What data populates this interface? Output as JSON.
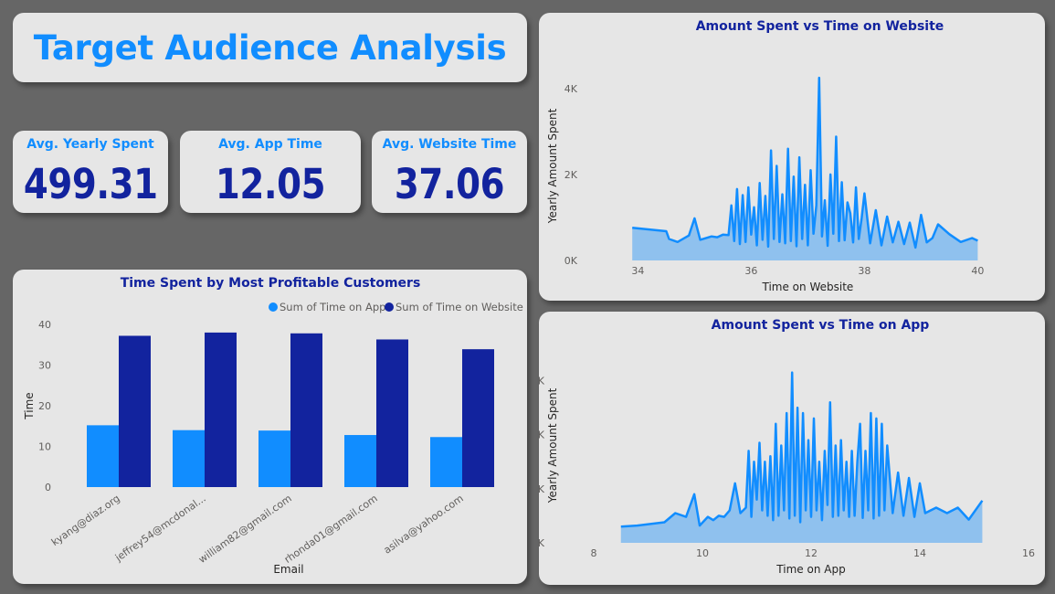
{
  "dashboard": {
    "title": "Target Audience Analysis"
  },
  "kpis": [
    {
      "label": "Avg. Yearly Spent",
      "value": "499.31"
    },
    {
      "label": "Avg. App Time",
      "value": "12.05"
    },
    {
      "label": "Avg. Website Time",
      "value": "37.06"
    }
  ],
  "colors": {
    "accent_light": "#118dff",
    "accent_dark": "#12239e",
    "area_fill": "#8fc1ee",
    "card_bg": "#e6e6e6",
    "page_bg": "#666666"
  },
  "chart_data": [
    {
      "type": "bar",
      "title": "Time Spent by Most Profitable Customers",
      "xlabel": "Email",
      "ylabel": "Time",
      "ylim": [
        0,
        40
      ],
      "yticks": [
        "0",
        "10",
        "20",
        "30",
        "40"
      ],
      "legend_position": "top-right",
      "categories": [
        "kyang@diaz.org",
        "jeffrey54@mcdonal...",
        "william82@gmail.com",
        "rhonda01@gmail.com",
        "asilva@yahoo.com"
      ],
      "series": [
        {
          "name": "Sum of Time on App",
          "color": "#118dff",
          "values": [
            15.2,
            14.0,
            13.9,
            12.8,
            12.3
          ]
        },
        {
          "name": "Sum of Time on Website",
          "color": "#12239e",
          "values": [
            37.2,
            38.0,
            37.8,
            36.3,
            33.9
          ]
        }
      ]
    },
    {
      "type": "area",
      "title": "Amount Spent vs Time on Website",
      "xlabel": "Time on Website",
      "ylabel": "Yearly Amount Spent",
      "xlim": [
        33.8,
        40.3
      ],
      "ylim": [
        0,
        4400
      ],
      "xticks": [
        "34",
        "36",
        "38",
        "40"
      ],
      "yticks": [
        "0K",
        "2K",
        "4K"
      ],
      "xtick_values": [
        34,
        36,
        38,
        40
      ],
      "ytick_values": [
        0,
        2000,
        4000
      ],
      "x": [
        33.9,
        34.5,
        34.55,
        34.7,
        34.9,
        35.0,
        35.1,
        35.3,
        35.4,
        35.5,
        35.6,
        35.65,
        35.7,
        35.75,
        35.8,
        35.85,
        35.9,
        35.95,
        36.0,
        36.05,
        36.1,
        36.15,
        36.2,
        36.25,
        36.3,
        36.35,
        36.4,
        36.45,
        36.5,
        36.55,
        36.6,
        36.65,
        36.7,
        36.75,
        36.8,
        36.85,
        36.9,
        36.95,
        37.0,
        37.05,
        37.1,
        37.15,
        37.2,
        37.25,
        37.3,
        37.35,
        37.4,
        37.45,
        37.5,
        37.55,
        37.6,
        37.65,
        37.7,
        37.75,
        37.8,
        37.85,
        37.9,
        37.95,
        38.0,
        38.1,
        38.2,
        38.3,
        38.4,
        38.5,
        38.6,
        38.7,
        38.8,
        38.9,
        39.0,
        39.1,
        39.2,
        39.3,
        39.5,
        39.7,
        39.9,
        40.0
      ],
      "y": [
        760,
        680,
        500,
        430,
        580,
        980,
        480,
        560,
        540,
        600,
        590,
        1280,
        450,
        1660,
        380,
        1520,
        430,
        1700,
        600,
        1240,
        350,
        1800,
        480,
        1500,
        320,
        2560,
        500,
        2200,
        430,
        1540,
        400,
        2600,
        450,
        1950,
        330,
        2400,
        500,
        1760,
        350,
        2100,
        620,
        1280,
        4250,
        560,
        1400,
        340,
        2000,
        620,
        2880,
        450,
        1820,
        470,
        1350,
        1100,
        420,
        1700,
        500,
        980,
        1560,
        400,
        1170,
        350,
        1020,
        420,
        900,
        380,
        880,
        300,
        1060,
        420,
        520,
        840,
        610,
        430,
        520,
        460
      ]
    },
    {
      "type": "area",
      "title": "Amount Spent vs Time on App",
      "xlabel": "Time on App",
      "ylabel": "Yearly Amount Spent",
      "xlim": [
        8,
        16
      ],
      "ylim": [
        0,
        3600
      ],
      "xticks": [
        "8",
        "10",
        "12",
        "14",
        "16"
      ],
      "yticks": [
        "0K",
        "1K",
        "2K",
        "3K"
      ],
      "xtick_values": [
        8,
        10,
        12,
        14,
        16
      ],
      "ytick_values": [
        0,
        1000,
        2000,
        3000
      ],
      "x": [
        8.5,
        8.8,
        9.3,
        9.5,
        9.7,
        9.85,
        9.95,
        10.1,
        10.2,
        10.3,
        10.4,
        10.5,
        10.6,
        10.7,
        10.8,
        10.85,
        10.9,
        10.95,
        11.0,
        11.05,
        11.1,
        11.15,
        11.2,
        11.25,
        11.3,
        11.35,
        11.4,
        11.45,
        11.5,
        11.55,
        11.6,
        11.65,
        11.7,
        11.75,
        11.8,
        11.85,
        11.9,
        11.95,
        12.0,
        12.05,
        12.1,
        12.15,
        12.2,
        12.25,
        12.3,
        12.35,
        12.4,
        12.45,
        12.5,
        12.55,
        12.6,
        12.65,
        12.7,
        12.75,
        12.8,
        12.85,
        12.9,
        12.95,
        13.0,
        13.05,
        13.1,
        13.15,
        13.2,
        13.25,
        13.3,
        13.35,
        13.4,
        13.5,
        13.6,
        13.7,
        13.8,
        13.9,
        14.0,
        14.1,
        14.3,
        14.5,
        14.7,
        14.9,
        15.15
      ],
      "y": [
        300,
        320,
        380,
        550,
        480,
        900,
        320,
        480,
        420,
        500,
        480,
        600,
        1100,
        550,
        650,
        1700,
        480,
        1500,
        800,
        1850,
        600,
        1500,
        500,
        1600,
        420,
        2200,
        500,
        1800,
        600,
        2400,
        450,
        3150,
        500,
        2500,
        380,
        2400,
        600,
        1900,
        480,
        2300,
        600,
        1500,
        420,
        1700,
        700,
        2600,
        480,
        1800,
        500,
        1900,
        600,
        1500,
        480,
        1700,
        500,
        1500,
        2200,
        460,
        1700,
        600,
        2400,
        450,
        2300,
        500,
        2200,
        600,
        1800,
        550,
        1300,
        500,
        1200,
        480,
        1100,
        550,
        650,
        550,
        650,
        430,
        780
      ]
    }
  ]
}
